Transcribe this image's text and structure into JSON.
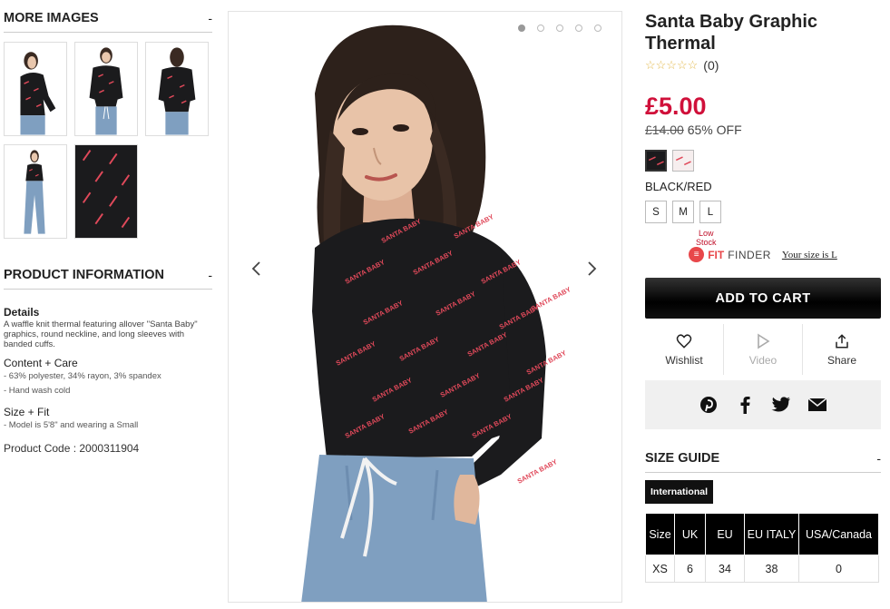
{
  "left": {
    "more_images_title": "MORE IMAGES",
    "more_images_toggle": "-",
    "product_info_title": "PRODUCT INFORMATION",
    "product_info_toggle": "-",
    "details_title": "Details",
    "details_text": "A waffle knit thermal featuring allover \"Santa Baby\" graphics, round neckline, and long sleeves with banded cuffs.",
    "content_title": "Content + Care",
    "content_lines": [
      "- 63% polyester, 34% rayon, 3% spandex",
      "- Hand wash cold"
    ],
    "size_fit_title": "Size + Fit",
    "size_fit_lines": [
      "- Model is 5'8\" and wearing a Small"
    ],
    "product_code": "Product Code : 2000311904"
  },
  "main": {
    "prev_arrow": "‹",
    "next_arrow": "›",
    "dot_count": 5,
    "active_dot": 0,
    "print_text": "SANTA BABY"
  },
  "product": {
    "title": "Santa Baby Graphic Thermal",
    "stars": "☆☆☆☆☆",
    "review_count": "(0)",
    "price": "£5.00",
    "original_price": "£14.00",
    "discount": "65% OFF",
    "color_name": "BLACK/RED",
    "sizes": [
      "S",
      "M",
      "L"
    ],
    "low_stock_note": "Low\nStock",
    "fitfinder_fit": "FIT",
    "fitfinder_finder": "FINDER",
    "fitfinder_link": "Your size is L",
    "add_to_cart": "ADD TO CART",
    "wishlist_label": "Wishlist",
    "video_label": "Video",
    "share_label": "Share"
  },
  "size_guide": {
    "title": "SIZE GUIDE",
    "toggle": "-",
    "tab": "International",
    "headers": [
      "Size",
      "UK",
      "EU",
      "EU ITALY",
      "USA/Canada"
    ],
    "rows": [
      [
        "XS",
        "6",
        "34",
        "38",
        "0"
      ]
    ]
  },
  "colors": {
    "price_red": "#d0103a",
    "shirt_black": "#1b1b1d",
    "print_red": "#e0495a",
    "denim": "#7f9fc0"
  }
}
